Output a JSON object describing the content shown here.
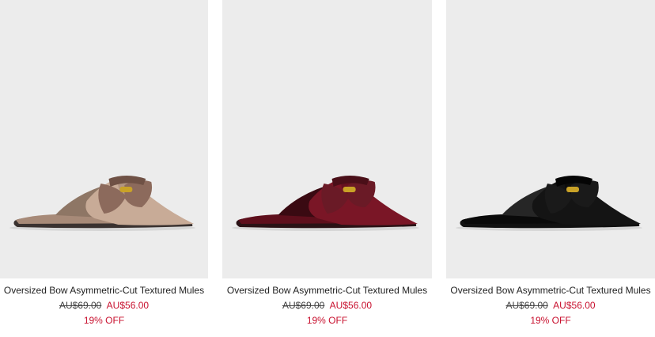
{
  "products": [
    {
      "title": "Oversized Bow Asymmetric-Cut Textured Mules",
      "old_price": "AU$69.00",
      "new_price": "AU$56.00",
      "discount": "19% OFF",
      "colors": {
        "upper": "#c8ab97",
        "shade": "#a78a78",
        "lining": "#8e7665",
        "bow": "#8c6a5c",
        "bow_dark": "#6f5145",
        "sole": "#3a3230"
      }
    },
    {
      "title": "Oversized Bow Asymmetric-Cut Textured Mules",
      "old_price": "AU$69.00",
      "new_price": "AU$56.00",
      "discount": "19% OFF",
      "colors": {
        "upper": "#7a1626",
        "shade": "#5e0f1c",
        "lining": "#3a0a12",
        "bow": "#6a1a26",
        "bow_dark": "#4a0f18",
        "sole": "#2a1215"
      }
    },
    {
      "title": "Oversized Bow Asymmetric-Cut Textured Mules",
      "old_price": "AU$69.00",
      "new_price": "AU$56.00",
      "discount": "19% OFF",
      "colors": {
        "upper": "#141414",
        "shade": "#0a0a0a",
        "lining": "#262626",
        "bow": "#1a1a1a",
        "bow_dark": "#050505",
        "sole": "#111111"
      }
    }
  ],
  "accent_color": "#c8102e"
}
